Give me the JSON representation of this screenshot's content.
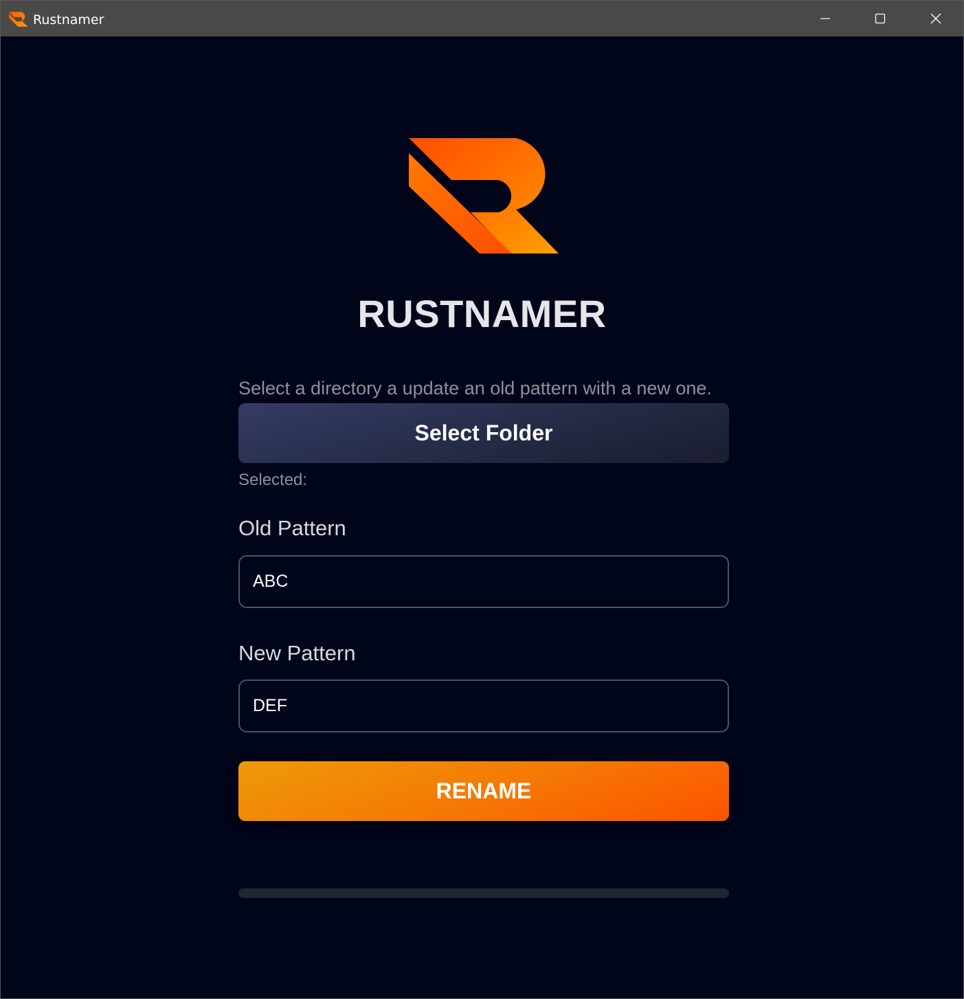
{
  "window": {
    "title": "Rustnamer",
    "controls": {
      "minimize_icon": "minimize-icon",
      "maximize_icon": "maximize-icon",
      "close_icon": "close-icon"
    }
  },
  "header": {
    "logo_icon": "rustnamer-logo",
    "app_name": "RUSTNAMER"
  },
  "form": {
    "instructions": "Select a directory a update an old pattern with a new one.",
    "select_folder_label": "Select Folder",
    "selected_label": "Selected:",
    "old_pattern": {
      "label": "Old Pattern",
      "value": "ABC"
    },
    "new_pattern": {
      "label": "New Pattern",
      "value": "DEF"
    },
    "rename_label": "RENAME",
    "progress_percent": 0
  },
  "colors": {
    "background": "#00051a",
    "titlebar": "#4b4947",
    "accent_orange": "#f47a05",
    "accent_orange_light": "#ee9a08",
    "accent_orange_dark": "#fd5300",
    "select_button": "#2b3152",
    "input_border": "#4e535f",
    "progress_track": "#1f2533"
  }
}
